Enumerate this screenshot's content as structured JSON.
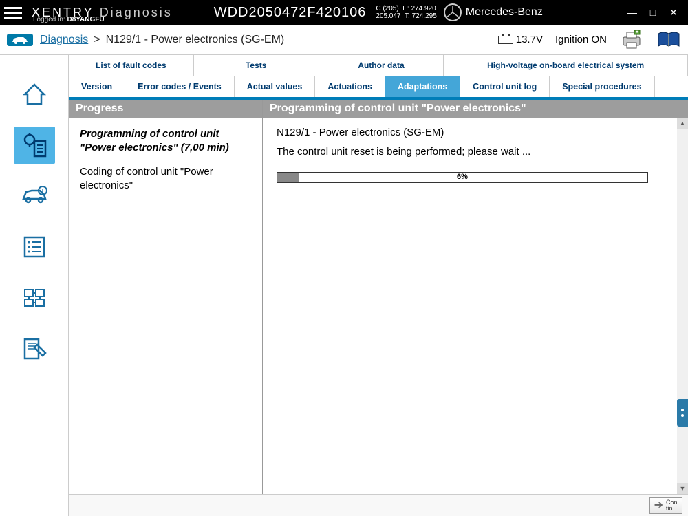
{
  "header": {
    "app_name_1": "XENTRY",
    "app_name_2": "Diagnosis",
    "logged_in_label": "Logged in:",
    "logged_in_user": "D8YANGFU",
    "vin": "WDD2050472F420106",
    "model_line1": "C (205)",
    "model_e": "E: 274.920",
    "model_line2": "205.047",
    "model_t": "T: 724.295",
    "brand": "Mercedes-Benz"
  },
  "breadcrumb": {
    "root": "Diagnosis",
    "sep": ">",
    "current": "N129/1 - Power electronics (SG-EM)"
  },
  "status": {
    "voltage": "13.7V",
    "ignition": "Ignition ON"
  },
  "tabs_upper": [
    "List of fault codes",
    "Tests",
    "Author data",
    "High-voltage on-board electrical system"
  ],
  "tabs_lower": [
    "Version",
    "Error codes / Events",
    "Actual values",
    "Actuations",
    "Adaptations",
    "Control unit log",
    "Special procedures"
  ],
  "tabs_lower_active_index": 4,
  "left_panel": {
    "title": "Progress",
    "step_active": "Programming of control unit \"Power electronics\" (7,00 min)",
    "step_next": "Coding of control unit \"Power electronics\""
  },
  "right_panel": {
    "title": "Programming of control unit \"Power electronics\"",
    "line1": "N129/1 - Power electronics (SG-EM)",
    "line2": "The control unit reset is being performed; please wait ...",
    "progress_percent": 6,
    "progress_label": "6%"
  },
  "footer": {
    "continue_label": "Con\ntin..."
  }
}
